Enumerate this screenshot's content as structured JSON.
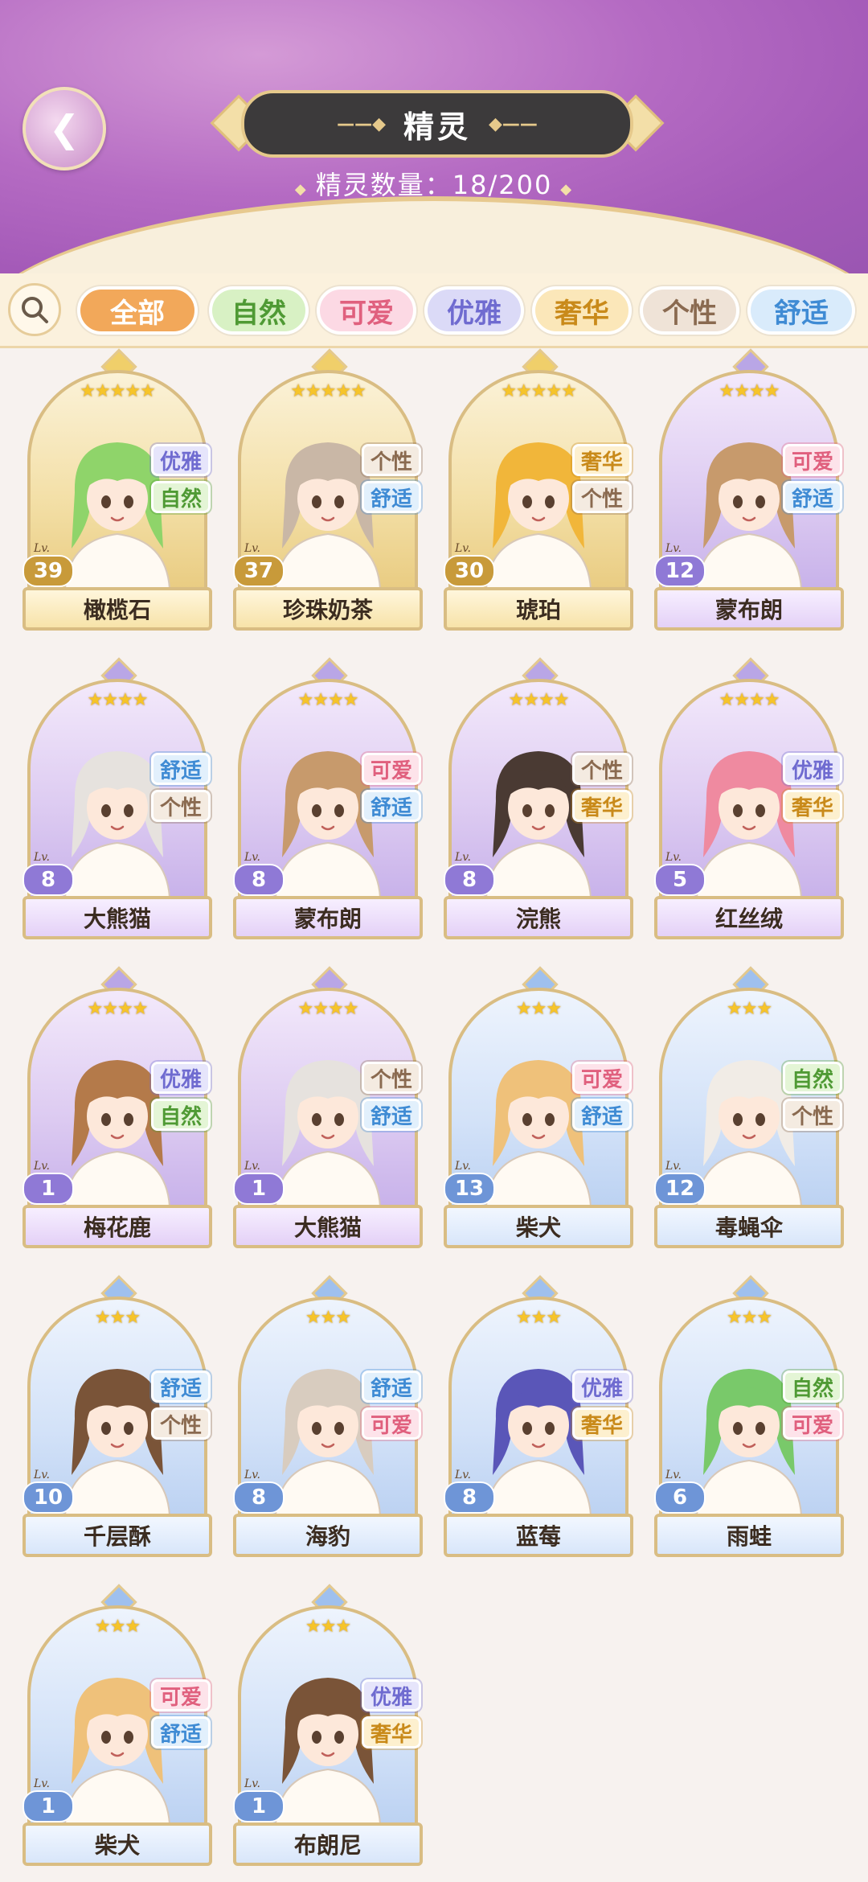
{
  "header": {
    "title": "精灵",
    "count_label": "精灵数量：",
    "count_value": "18/200",
    "back_icon": "wing-back-icon"
  },
  "filters": {
    "search_icon": "magnifier-icon",
    "chips": [
      {
        "label": "全部",
        "color": "#f2a85a",
        "text": "#ffffff",
        "selected": true
      },
      {
        "label": "自然",
        "color": "#d8f1c4",
        "text": "#4f9a34",
        "selected": false
      },
      {
        "label": "可爱",
        "color": "#fcd9e4",
        "text": "#e0607e",
        "selected": false
      },
      {
        "label": "优雅",
        "color": "#dbdaf7",
        "text": "#6f6bd0",
        "selected": false
      },
      {
        "label": "奢华",
        "color": "#fbe7b9",
        "text": "#c98a1a",
        "selected": false
      },
      {
        "label": "个性",
        "color": "#efe3d7",
        "text": "#8a6a50",
        "selected": false
      },
      {
        "label": "舒适",
        "color": "#d9ebfb",
        "text": "#3f8bd4",
        "selected": false
      }
    ]
  },
  "tag_colors": {
    "优雅": {
      "bg": "#e6e5fb",
      "text": "#6f6bd0"
    },
    "自然": {
      "bg": "#e4f5d6",
      "text": "#4f9a34"
    },
    "个性": {
      "bg": "#f4ebe1",
      "text": "#8a6a50"
    },
    "舒适": {
      "bg": "#e2f0fc",
      "text": "#3f8bd4"
    },
    "奢华": {
      "bg": "#fdf0cf",
      "text": "#c98a1a"
    },
    "可爱": {
      "bg": "#fde3ea",
      "text": "#e0607e"
    }
  },
  "cards": [
    {
      "name": "橄榄石",
      "level": "39",
      "stars": "★★★★★",
      "frame": "gold",
      "tags": [
        "优雅",
        "自然"
      ],
      "hair": "#8fd46a"
    },
    {
      "name": "珍珠奶茶",
      "level": "37",
      "stars": "★★★★★",
      "frame": "gold",
      "tags": [
        "个性",
        "舒适"
      ],
      "hair": "#c9b7a6"
    },
    {
      "name": "琥珀",
      "level": "30",
      "stars": "★★★★★",
      "frame": "gold",
      "tags": [
        "奢华",
        "个性"
      ],
      "hair": "#f1b63a"
    },
    {
      "name": "蒙布朗",
      "level": "12",
      "stars": "★★★★",
      "frame": "purple",
      "tags": [
        "可爱",
        "舒适"
      ],
      "hair": "#c79a6c"
    },
    {
      "name": "大熊猫",
      "level": "8",
      "stars": "★★★★",
      "frame": "purple",
      "tags": [
        "舒适",
        "个性"
      ],
      "hair": "#e6e2de"
    },
    {
      "name": "蒙布朗",
      "level": "8",
      "stars": "★★★★",
      "frame": "purple",
      "tags": [
        "可爱",
        "舒适"
      ],
      "hair": "#c79a6c"
    },
    {
      "name": "浣熊",
      "level": "8",
      "stars": "★★★★",
      "frame": "purple",
      "tags": [
        "个性",
        "奢华"
      ],
      "hair": "#4a3a33"
    },
    {
      "name": "红丝绒",
      "level": "5",
      "stars": "★★★★",
      "frame": "purple",
      "tags": [
        "优雅",
        "奢华"
      ],
      "hair": "#ef8aa0"
    },
    {
      "name": "梅花鹿",
      "level": "1",
      "stars": "★★★★",
      "frame": "purple",
      "tags": [
        "优雅",
        "自然"
      ],
      "hair": "#b47a4a"
    },
    {
      "name": "大熊猫",
      "level": "1",
      "stars": "★★★★",
      "frame": "purple",
      "tags": [
        "个性",
        "舒适"
      ],
      "hair": "#e6e2de"
    },
    {
      "name": "柴犬",
      "level": "13",
      "stars": "★★★",
      "frame": "blue",
      "tags": [
        "可爱",
        "舒适"
      ],
      "hair": "#efc17a"
    },
    {
      "name": "毒蝇伞",
      "level": "12",
      "stars": "★★★",
      "frame": "blue",
      "tags": [
        "自然",
        "个性"
      ],
      "hair": "#f1ece6"
    },
    {
      "name": "千层酥",
      "level": "10",
      "stars": "★★★",
      "frame": "blue",
      "tags": [
        "舒适",
        "个性"
      ],
      "hair": "#7a5438"
    },
    {
      "name": "海豹",
      "level": "8",
      "stars": "★★★",
      "frame": "blue",
      "tags": [
        "舒适",
        "可爱"
      ],
      "hair": "#d8ccbf"
    },
    {
      "name": "蓝莓",
      "level": "8",
      "stars": "★★★",
      "frame": "blue",
      "tags": [
        "优雅",
        "奢华"
      ],
      "hair": "#5a56b8"
    },
    {
      "name": "雨蛙",
      "level": "6",
      "stars": "★★★",
      "frame": "blue",
      "tags": [
        "自然",
        "可爱"
      ],
      "hair": "#79c96a"
    },
    {
      "name": "柴犬",
      "level": "1",
      "stars": "★★★",
      "frame": "blue",
      "tags": [
        "可爱",
        "舒适"
      ],
      "hair": "#efc17a"
    },
    {
      "name": "布朗尼",
      "level": "1",
      "stars": "★★★",
      "frame": "blue",
      "tags": [
        "优雅",
        "奢华"
      ],
      "hair": "#7a5438"
    }
  ]
}
